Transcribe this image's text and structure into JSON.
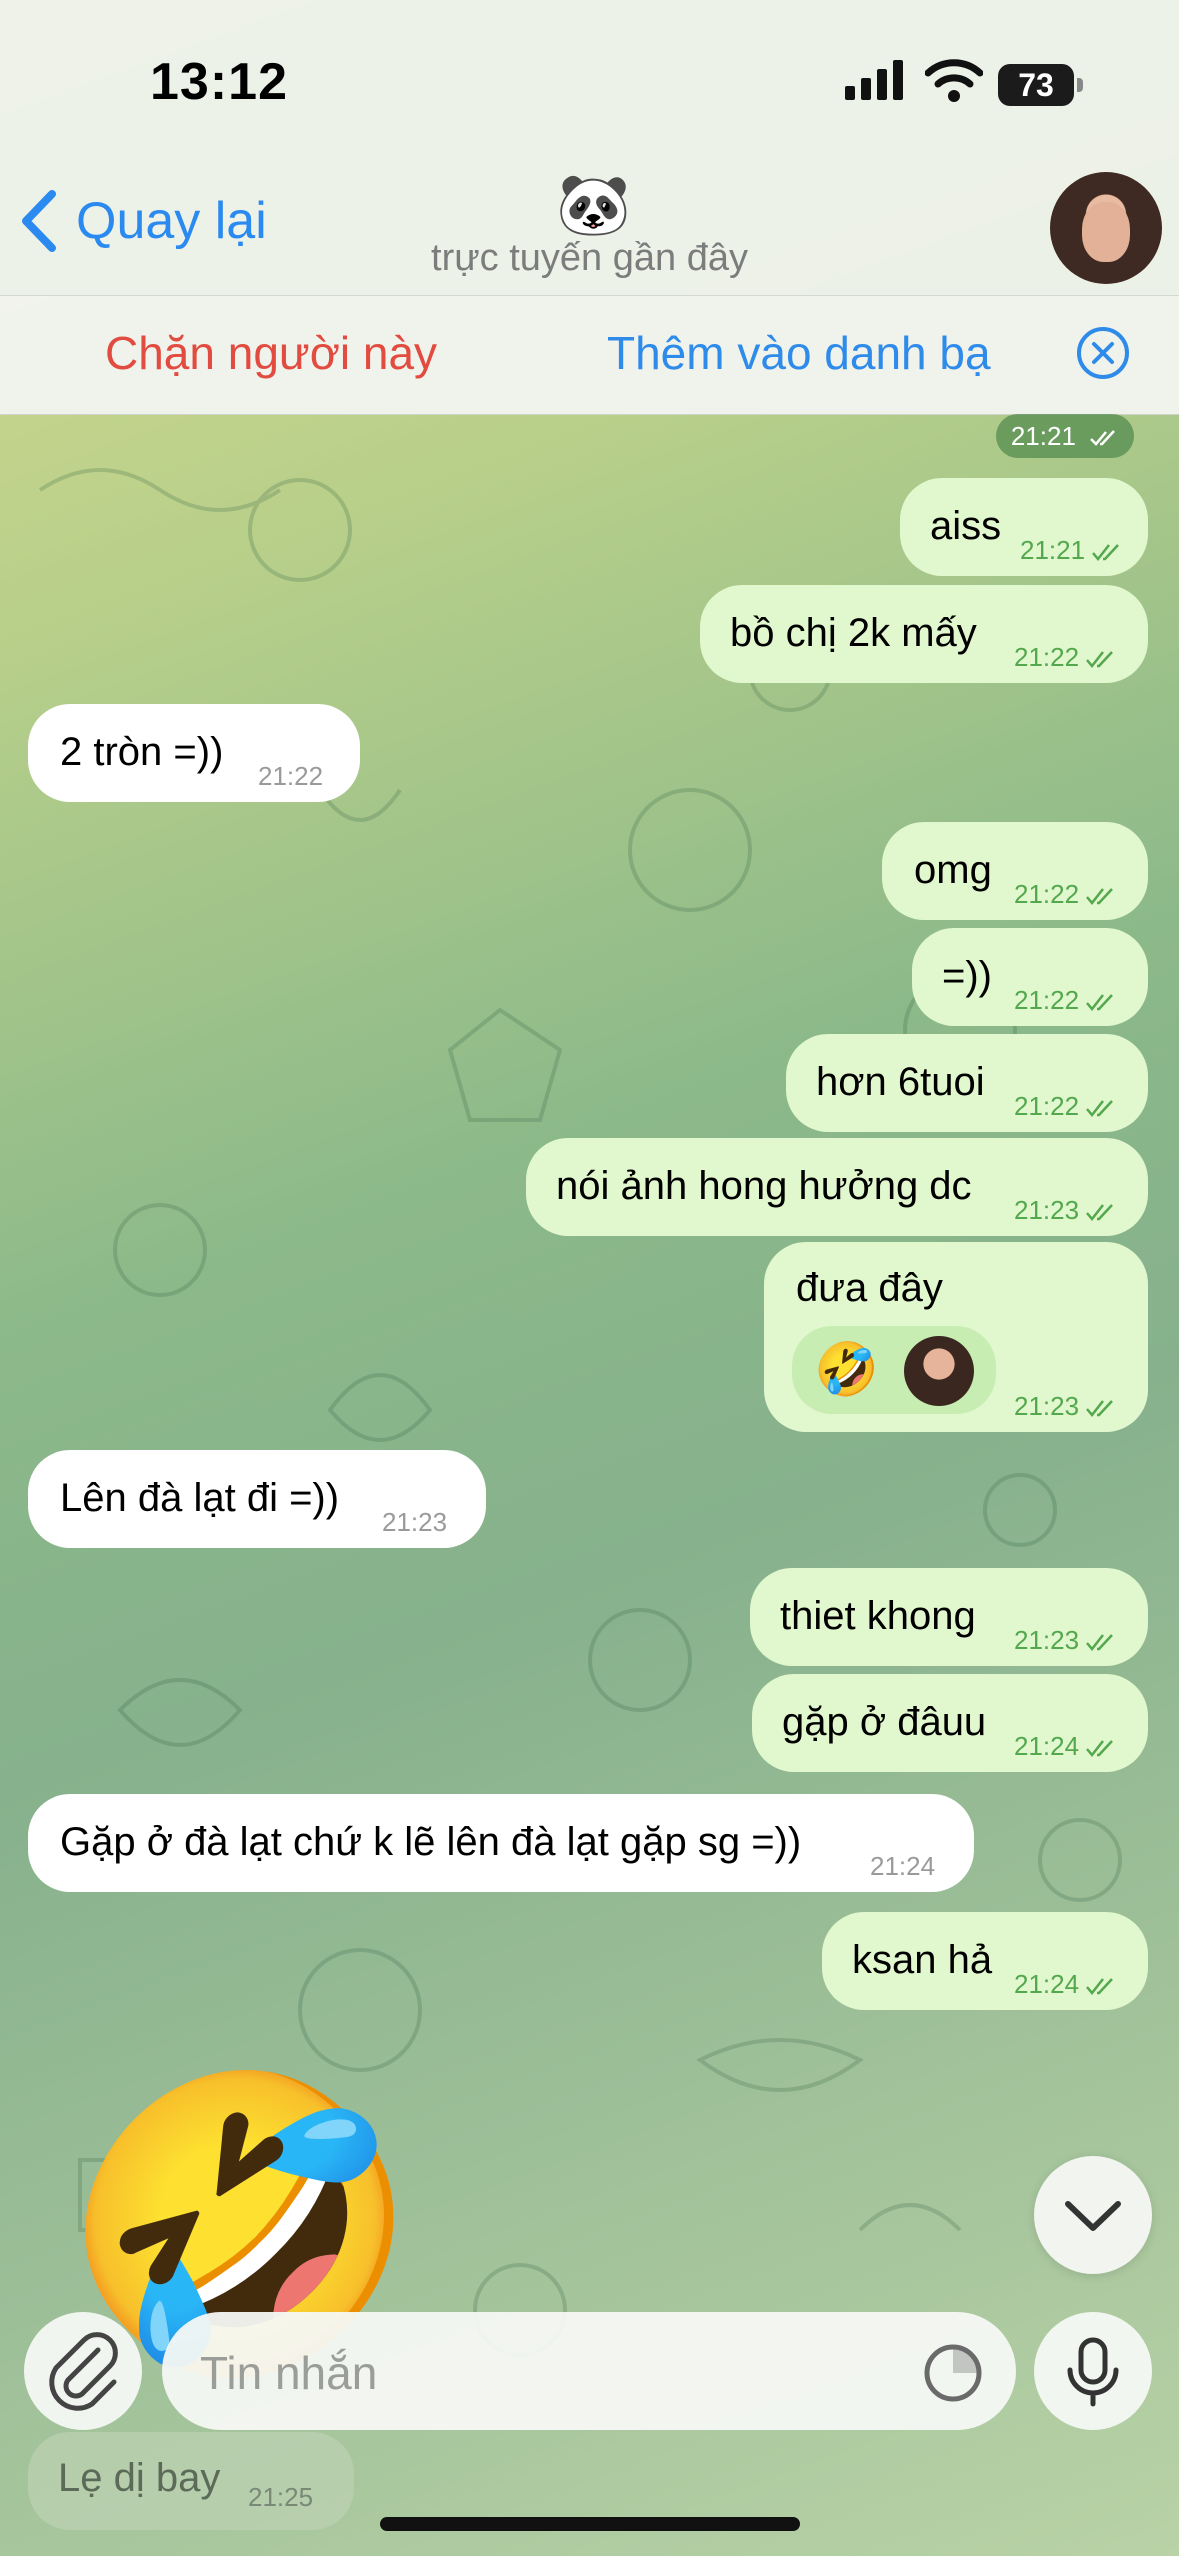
{
  "status_bar": {
    "time": "13:12",
    "battery": "73"
  },
  "header": {
    "back_label": "Quay lại",
    "title_emoji": "🐼",
    "subtitle": "trực tuyến gần đây"
  },
  "action_bar": {
    "block_label": "Chặn người này",
    "add_contact_label": "Thêm vào danh bạ"
  },
  "date_badge": "21:21",
  "messages": [
    {
      "dir": "out",
      "text": "aiss",
      "time": "21:21"
    },
    {
      "dir": "out",
      "text": "bồ chị 2k mấy",
      "time": "21:22"
    },
    {
      "dir": "in",
      "text": "2 tròn =))",
      "time": "21:22"
    },
    {
      "dir": "out",
      "text": "omg",
      "time": "21:22"
    },
    {
      "dir": "out",
      "text": "=))",
      "time": "21:22"
    },
    {
      "dir": "out",
      "text": "hơn 6tuoi",
      "time": "21:22"
    },
    {
      "dir": "out",
      "text": "nói ảnh hong hưởng dc",
      "time": "21:23"
    },
    {
      "dir": "out",
      "text": "đưa đây",
      "time": "21:23",
      "reaction": "🤣"
    },
    {
      "dir": "in",
      "text": "Lên đà lạt đi =))",
      "time": "21:23"
    },
    {
      "dir": "out",
      "text": "thiet khong",
      "time": "21:23"
    },
    {
      "dir": "out",
      "text": "gặp ở đâuu",
      "time": "21:24"
    },
    {
      "dir": "in",
      "text": "Gặp ở đà lạt chứ k lẽ lên đà lạt gặp sg =))",
      "time": "21:24"
    },
    {
      "dir": "out",
      "text": "ksan hả",
      "time": "21:24"
    },
    {
      "dir": "in",
      "text": "Lẹ dị bay",
      "time": "21:25"
    }
  ],
  "big_emoji": "🤣",
  "composer": {
    "placeholder": "Tin nhắn"
  },
  "colors": {
    "accent": "#2b8af0",
    "block": "#e24b3f",
    "outgoing": "#e1f7cd",
    "incoming": "#ffffff",
    "time_out": "#53a84e"
  }
}
